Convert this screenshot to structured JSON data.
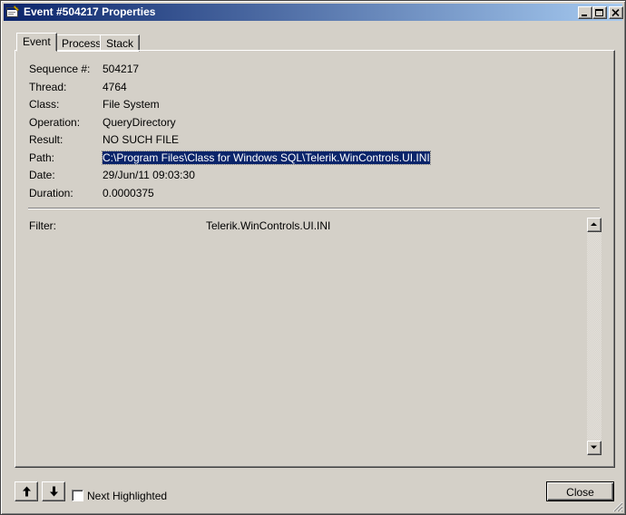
{
  "window": {
    "title": "Event #504217 Properties"
  },
  "tabs": [
    {
      "label": "Event",
      "active": true
    },
    {
      "label": "Process",
      "active": false
    },
    {
      "label": "Stack",
      "active": false
    }
  ],
  "fields": [
    {
      "label": "Sequence #:",
      "value": "504217"
    },
    {
      "label": "Thread:",
      "value": "4764"
    },
    {
      "label": "Class:",
      "value": "File System"
    },
    {
      "label": "Operation:",
      "value": "QueryDirectory"
    },
    {
      "label": "Result:",
      "value": "NO SUCH FILE"
    },
    {
      "label": "Path:",
      "value": "C:\\Program Files\\Class for Windows SQL\\Telerik.WinControls.UI.INI",
      "selected": true
    },
    {
      "label": "Date:",
      "value": "29/Jun/11 09:03:30"
    },
    {
      "label": "Duration:",
      "value": "0.0000375"
    }
  ],
  "details": [
    {
      "label": "Filter:",
      "value": "Telerik.WinControls.UI.INI"
    }
  ],
  "footer": {
    "next_highlighted_label": "Next Highlighted",
    "next_highlighted_checked": false,
    "close_label": "Close"
  },
  "colors": {
    "title_gradient_start": "#0a246a",
    "title_gradient_end": "#a6caf0",
    "dialog_face": "#d4d0c8",
    "selection": "#0a246a"
  },
  "icons": {
    "app": "properties-window-icon",
    "up": "arrow-up-icon",
    "down": "arrow-down-icon"
  }
}
